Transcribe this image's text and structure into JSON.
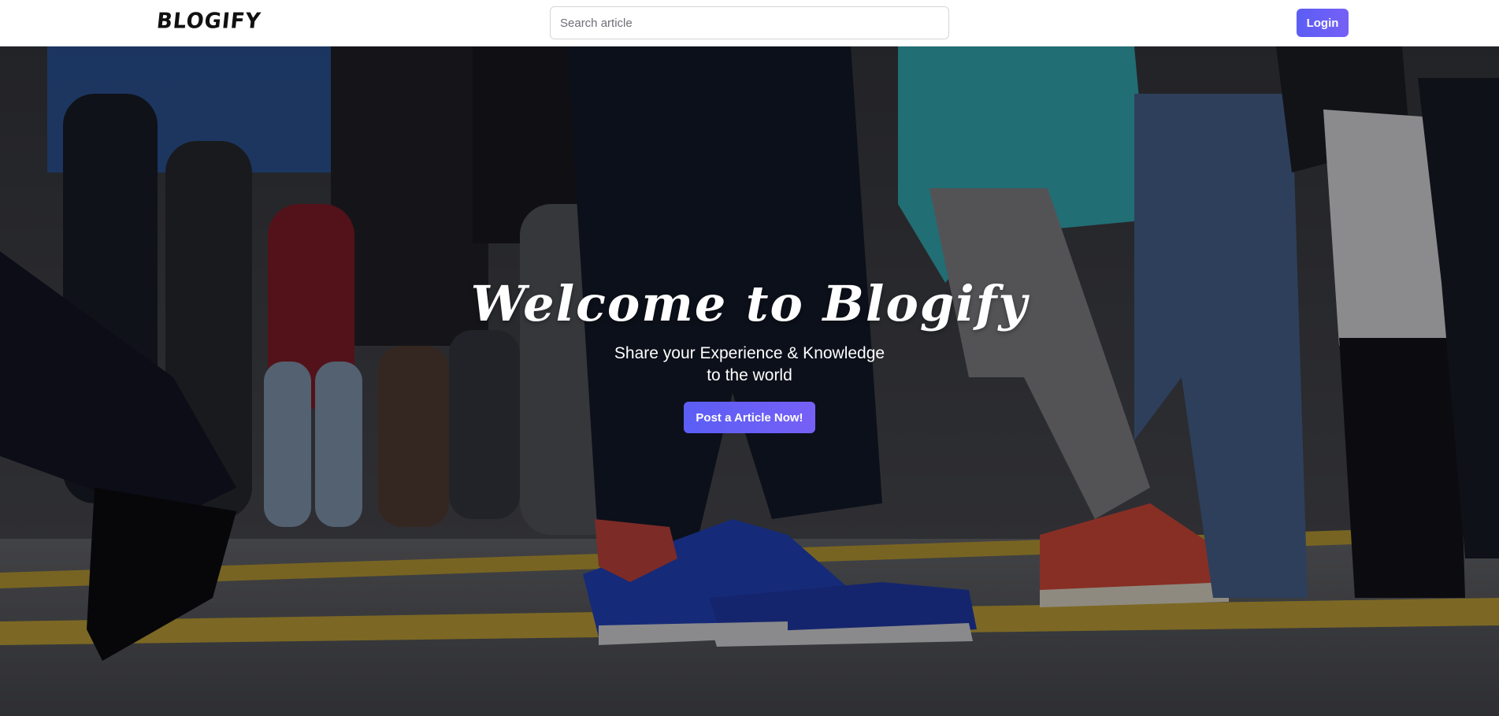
{
  "navbar": {
    "logo_text": "BLOGIFY",
    "search": {
      "placeholder": "Search article",
      "value": ""
    },
    "login_label": "Login"
  },
  "hero": {
    "title": "Welcome to Blogify",
    "subtitle_line1": "Share your Experience & Knowledge",
    "subtitle_line2": "to the world",
    "cta_label": "Post a Article Now!",
    "background_image": "people-walking-crosswalk"
  },
  "colors": {
    "accent": "#6360f6",
    "navbar_bg": "#ffffff",
    "logo": "#111111",
    "hero_text": "#ffffff"
  }
}
